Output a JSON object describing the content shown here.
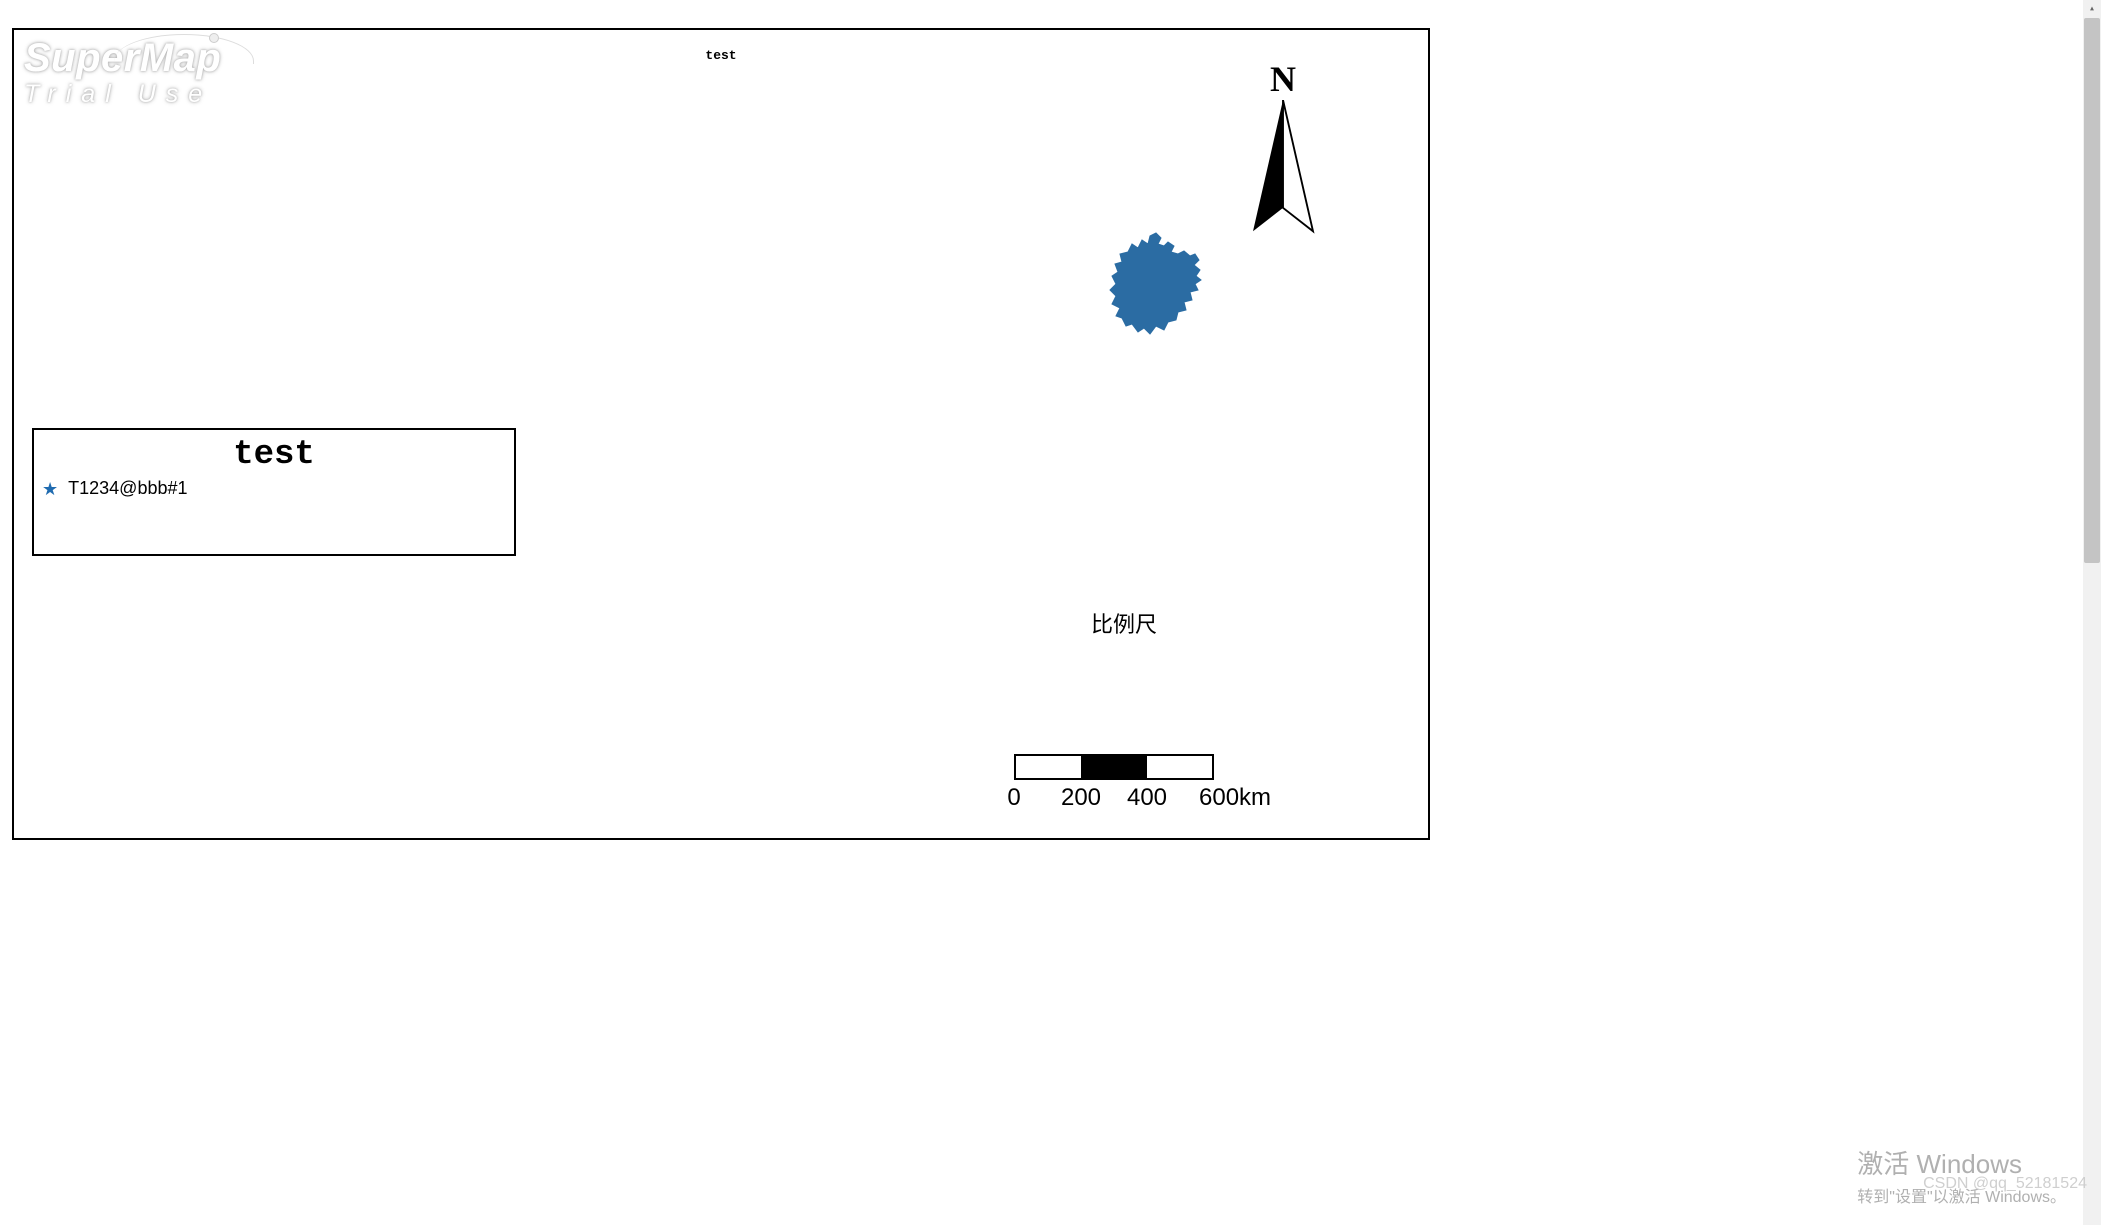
{
  "watermark": {
    "brand": "SuperMap",
    "trial": "Trial Use"
  },
  "map": {
    "title": "test",
    "compass_letter": "N",
    "region_fill": "#2b6ca3"
  },
  "legend": {
    "title": "test",
    "items": [
      {
        "marker": "★",
        "label": "T1234@bbb#1"
      }
    ]
  },
  "scale": {
    "label": "比例尺",
    "ticks": [
      "0",
      "200",
      "400",
      "600"
    ],
    "unit": "km"
  },
  "os_watermark": {
    "line1": "激活 Windows",
    "line2": "转到\"设置\"以激活 Windows。"
  },
  "attribution": "CSDN @qq_52181524"
}
